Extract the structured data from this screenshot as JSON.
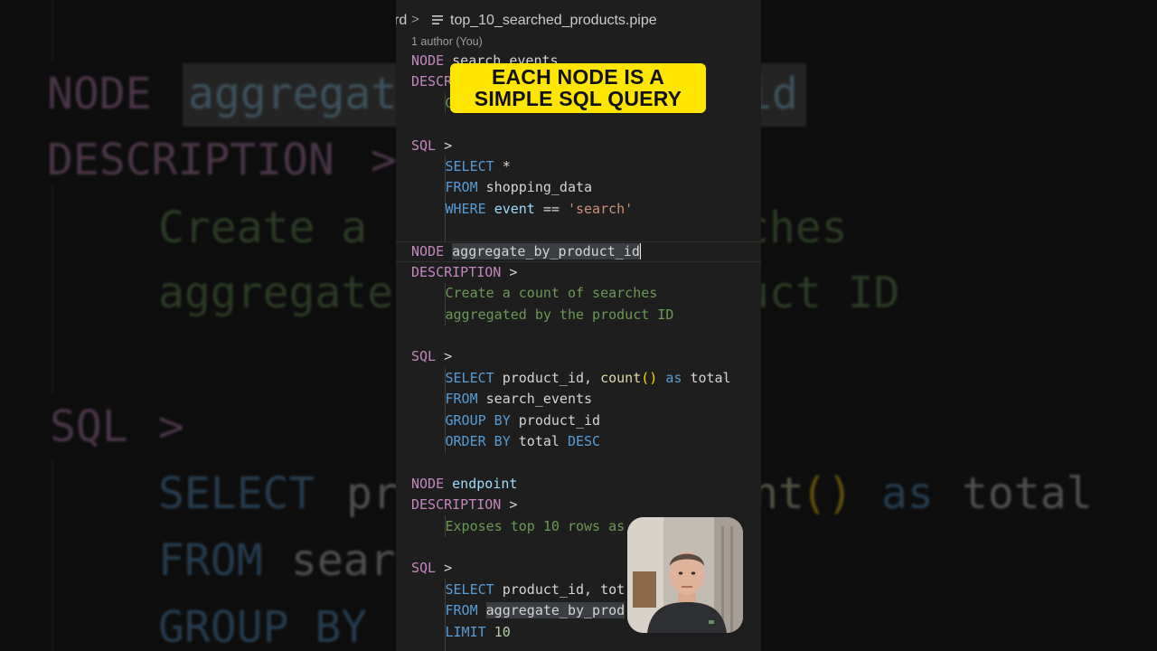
{
  "breadcrumb": {
    "prev_segment": "rd",
    "separator": ">",
    "file_icon": "hamburger-file-icon",
    "filename": "top_10_searched_products.pipe"
  },
  "blame": {
    "authors": "1 author (You)"
  },
  "caption": {
    "line1": "EACH NODE IS A",
    "line2": "SIMPLE SQL QUERY"
  },
  "code": {
    "kw_node": "NODE",
    "kw_description": "DESCRIPTION",
    "kw_sql": "SQL",
    "arrow": ">",
    "node1_name": "search_events",
    "node1_desc_partial": "G",
    "node1_select": "SELECT",
    "node1_star": "*",
    "node1_from": "FROM",
    "node1_table": "shopping_data",
    "node1_where": "WHERE",
    "node1_col": "event",
    "node1_op": "==",
    "node1_val": "'search'",
    "node2_name": "aggregate_by_product_id",
    "node2_desc_1": "Create a count of searches",
    "node2_desc_2": "aggregated by the product ID",
    "node2_select": "SELECT",
    "node2_cols": "product_id,",
    "node2_fn": "count",
    "node2_parens": "()",
    "node2_as": "as",
    "node2_alias": "total",
    "node2_from": "FROM",
    "node2_table": "search_events",
    "node2_group": "GROUP BY",
    "node2_group_col": "product_id",
    "node2_order": "ORDER BY",
    "node2_order_col": "total",
    "node2_desc_kw": "DESC",
    "node3_name": "endpoint",
    "node3_desc": "Exposes top 10 rows as",
    "node3_select": "SELECT",
    "node3_cols": "product_id, tot",
    "node3_from": "FROM",
    "node3_table": "aggregate_by_prod",
    "node3_limit": "LIMIT",
    "node3_limit_val": "10"
  },
  "background_zoom": {
    "node_kw": "NODE",
    "node_name_left": "aggregat",
    "node_name_right": "id",
    "description_kw": "DESCRIPTION",
    "arrow": ">",
    "desc1_left": "Create a",
    "desc1_right": "ches",
    "desc2_left": "aggregate",
    "desc2_right": "uct ID",
    "sql_kw": "SQL",
    "select_kw": "SELECT",
    "select_rest": "pr",
    "count_frag": "nt",
    "parens": "()",
    "as_kw": "as",
    "total": "total",
    "from_kw": "FROM",
    "from_rest": "sear",
    "group_kw": "GROUP BY"
  },
  "colors": {
    "editor_bg": "#1e1e1e",
    "keyword_node": "#c586c0",
    "keyword_sql": "#569cd6",
    "identifier": "#9cdcfe",
    "string": "#ce9178",
    "comment_desc": "#6a9955",
    "caption_bg": "#ffe600"
  },
  "webcam": {
    "label": "presenter-webcam"
  }
}
